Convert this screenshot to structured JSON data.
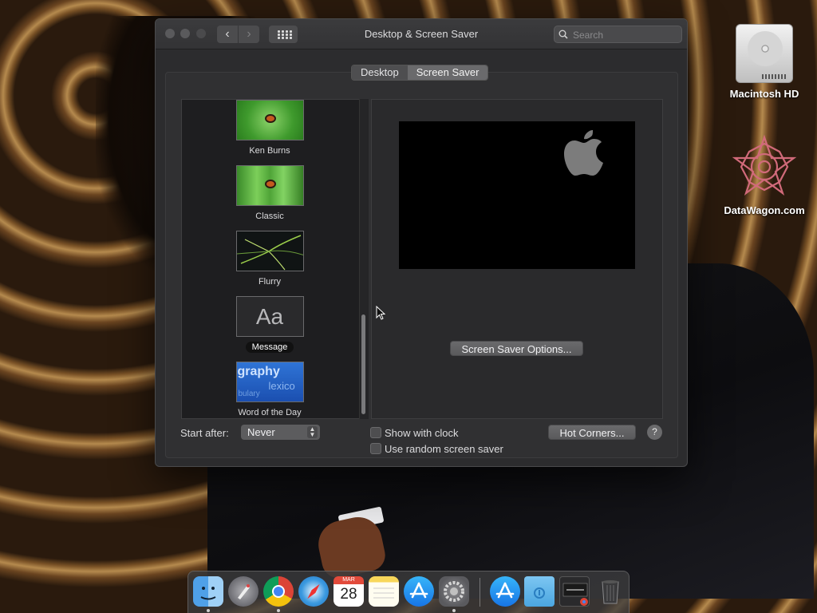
{
  "window": {
    "title": "Desktop & Screen Saver",
    "search_placeholder": "Search",
    "nav_back_icon": "chevron-left-icon",
    "nav_forward_icon": "chevron-right-icon",
    "grid_icon": "grid-icon"
  },
  "tabs": [
    {
      "label": "Desktop",
      "active": false
    },
    {
      "label": "Screen Saver",
      "active": true
    }
  ],
  "savers": [
    {
      "label": "Ken Burns",
      "selected": false
    },
    {
      "label": "Classic",
      "selected": false
    },
    {
      "label": "Flurry",
      "selected": false
    },
    {
      "label": "Message",
      "selected": true,
      "thumb_text": "Aa"
    },
    {
      "label": "Word of the Day",
      "selected": false,
      "thumb_text": "graphy"
    }
  ],
  "preview": {
    "options_button": "Screen Saver Options..."
  },
  "bottom": {
    "start_after_label": "Start after:",
    "start_after_value": "Never",
    "show_clock_label": "Show with clock",
    "show_clock_checked": false,
    "random_label": "Use random screen saver",
    "random_checked": false,
    "hot_corners_button": "Hot Corners...",
    "help_button": "?"
  },
  "desktop_icons": [
    {
      "label": "Macintosh HD",
      "icon": "hard-drive-icon"
    },
    {
      "label": "DataWagon.com",
      "icon": "datawagon-logo-icon"
    }
  ],
  "dock": [
    {
      "name": "finder",
      "icon": "finder-icon",
      "running": true
    },
    {
      "name": "launchpad",
      "icon": "launchpad-icon",
      "running": false
    },
    {
      "name": "chrome",
      "icon": "chrome-icon",
      "running": true
    },
    {
      "name": "safari",
      "icon": "safari-icon",
      "running": false
    },
    {
      "name": "calendar",
      "icon": "calendar-icon",
      "running": false,
      "month": "MAR",
      "day": "28"
    },
    {
      "name": "notes",
      "icon": "notes-icon",
      "running": false
    },
    {
      "name": "app-store",
      "icon": "app-store-icon",
      "running": false
    },
    {
      "name": "system-preferences",
      "icon": "system-preferences-icon",
      "running": true
    },
    {
      "name": "app-store-download",
      "icon": "app-store-icon",
      "running": false
    },
    {
      "name": "downloads-folder",
      "icon": "folder-icon",
      "running": false
    },
    {
      "name": "google-chrome-stack",
      "icon": "stack-icon",
      "running": false
    },
    {
      "name": "trash",
      "icon": "trash-icon",
      "running": false
    }
  ]
}
